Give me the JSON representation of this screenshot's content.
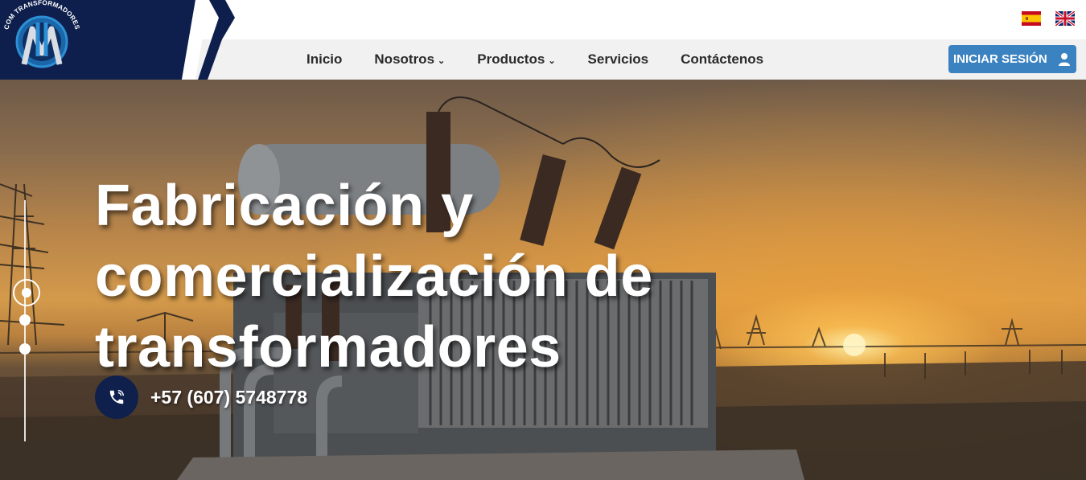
{
  "brand": {
    "logo_text": "COM TRANSFORMADORES",
    "colors": {
      "navy": "#0e1f4d",
      "accent_blue": "#3a82c0"
    }
  },
  "language_switcher": {
    "options": [
      {
        "icon": "spain-flag-icon"
      },
      {
        "icon": "uk-flag-icon"
      }
    ]
  },
  "nav": {
    "items": [
      {
        "label": "Inicio",
        "has_dropdown": false
      },
      {
        "label": "Nosotros",
        "has_dropdown": true
      },
      {
        "label": "Productos",
        "has_dropdown": true
      },
      {
        "label": "Servicios",
        "has_dropdown": false
      },
      {
        "label": "Contáctenos",
        "has_dropdown": false
      }
    ],
    "dropdown_icon": "chevron-down-icon"
  },
  "login": {
    "label": "INICIAR SESIÓN",
    "icon": "user-icon"
  },
  "hero": {
    "title": "Fabricación y comercialización de transformadores",
    "phone": "+57 (607) 5748778",
    "phone_icon": "phone-icon",
    "slides": {
      "count": 3,
      "active": 1
    }
  }
}
